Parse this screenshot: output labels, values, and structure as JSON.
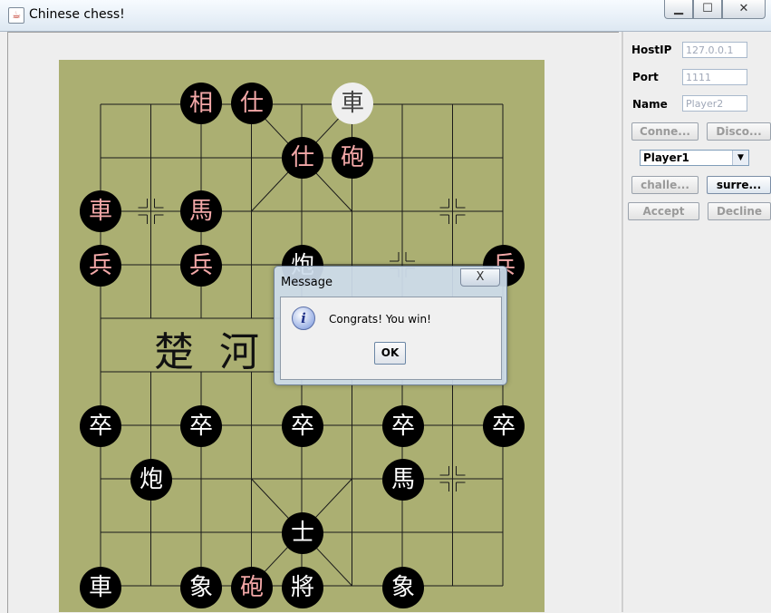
{
  "window": {
    "title": "Chinese chess!",
    "minimize_glyph": "▁",
    "maximize_glyph": "☐",
    "close_glyph": "✕"
  },
  "side_panel": {
    "host_label": "HostIP",
    "host_value": "127.0.0.1",
    "port_label": "Port",
    "port_value": "1111",
    "name_label": "Name",
    "name_value": "Player2",
    "connect_label": "Conne...",
    "disconnect_label": "Disco...",
    "player_select_value": "Player1",
    "challenge_label": "challe...",
    "surrender_label": "surre...",
    "accept_label": "Accept",
    "decline_label": "Decline"
  },
  "board": {
    "river_left": "楚",
    "river_right": "河",
    "pieces": [
      {
        "text": "相",
        "color": "red"
      },
      {
        "text": "仕",
        "color": "red"
      },
      {
        "text": "車",
        "color": "selected"
      },
      {
        "text": "仕",
        "color": "red"
      },
      {
        "text": "砲",
        "color": "red"
      },
      {
        "text": "車",
        "color": "red"
      },
      {
        "text": "馬",
        "color": "red"
      },
      {
        "text": "兵",
        "color": "red"
      },
      {
        "text": "兵",
        "color": "red"
      },
      {
        "text": "炮",
        "color": "white"
      },
      {
        "text": "兵",
        "color": "red"
      },
      {
        "text": "卒",
        "color": "white"
      },
      {
        "text": "卒",
        "color": "white"
      },
      {
        "text": "卒",
        "color": "white"
      },
      {
        "text": "卒",
        "color": "white"
      },
      {
        "text": "卒",
        "color": "white"
      },
      {
        "text": "炮",
        "color": "white"
      },
      {
        "text": "馬",
        "color": "white"
      },
      {
        "text": "士",
        "color": "white"
      },
      {
        "text": "車",
        "color": "white"
      },
      {
        "text": "象",
        "color": "white"
      },
      {
        "text": "砲",
        "color": "red"
      },
      {
        "text": "將",
        "color": "white"
      },
      {
        "text": "象",
        "color": "white"
      }
    ]
  },
  "dialog": {
    "title": "Message",
    "close_glyph": "X",
    "icon_glyph": "i",
    "message": "Congrats! You win!",
    "ok_label": "OK"
  }
}
